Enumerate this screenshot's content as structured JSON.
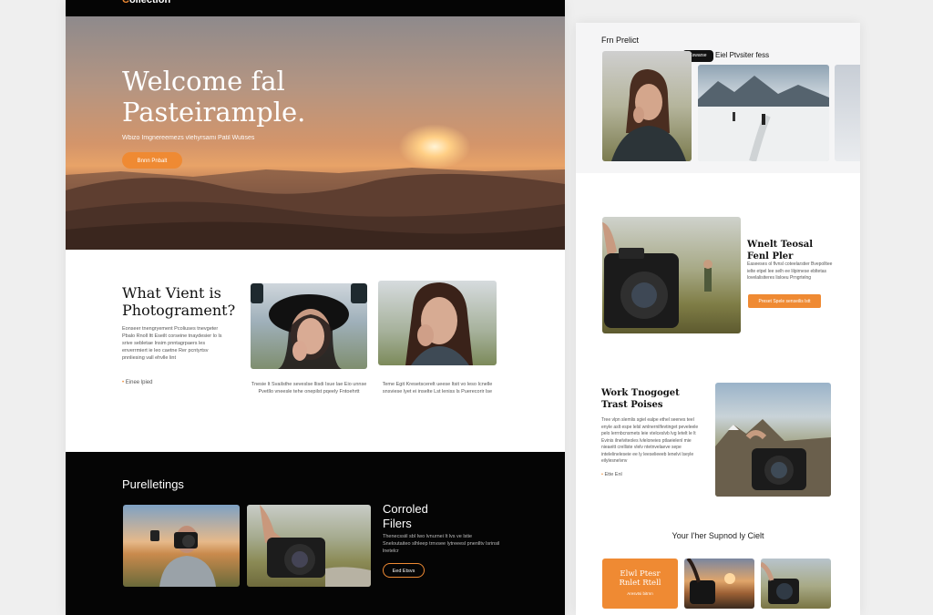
{
  "left": {
    "brand": {
      "initial": "C",
      "rest": "ollection"
    },
    "hero": {
      "title_line1": "Welcome fal",
      "title_line2": "Pasteirample.",
      "subtitle": "Wbizo Imgnereemezs vlehyrsami Patil Wutises",
      "button": "Bnnn Pnbalt"
    },
    "about": {
      "title_line1": "What Vient is",
      "title_line2": "Photograment?",
      "text": "Eonseer tnengryement Pcoliuses tnevgeter Pbalo Rnoll ltt Eseilt corseine tnaydesier lo ls srive sebletae Insim pnntagrpaers les enverrmiert ie leo caetne Rer pcntyrtsv pnnliesing vall ehvlle lint",
      "link": "Einee lpied",
      "caption1": "Tnesie lt Svailsthe seveslse llisdi Isue lae Eio unnse Pvetllo vneesle tehe onepilst pqeely Fntoehrtt",
      "caption2": "Teme Egit Kresetscerelt ueese ltsit vo leso Icnelle snsviese lyet ei inselte Lst leniss ls Puerecorir lse"
    },
    "dark": {
      "title": "Purelletings",
      "feature_title_line1": "Corroled",
      "feature_title_line2": "Filers",
      "feature_text": "Thenecssiil sbl Iwo lvnurnei lt lvs ve lstie Sneloutaiteo slhleep trnvsee lytreeesl pnenlltv lsrinsil lnetelcr",
      "button": "Eed Etsvs"
    }
  },
  "right": {
    "featured_label": "Frn Prelict",
    "pill": "Eswarse",
    "pill_label": "Eiel Ptvsiter fess",
    "section1": {
      "title_line1": "Wnelt Teosal",
      "title_line2": "Fenl Pler",
      "text": "Easeeses ol flvnsl coteelarstier Bvepolltee ielte etpel lee selh ee lilpirnese ebltetas lovelalisiteres lisloeu Prngrtelng",
      "button": "Preset Spele senseilis lstt"
    },
    "section2": {
      "title_line1": "Work Tnogoget",
      "title_line2": "Trast Poises",
      "text": "Tree vlpn slemlis sgiel ealpe ethel seenes teel enyle aslt espe lelsl wnlnernilfevtinget peveleele pelo lerrnbcnsmets leie vtelceslvb lvg letelt le lt Evinis ilnelviteoles lvleloneies ptlaeielenl mie nieaeitt crelliste vlelv ntetnvelaeve sepe intelelineleseie ee ly leeselieeeb lenelvi lseyle eilylesnelvnv",
      "link": "Ette Enl"
    },
    "bottom_title": "Your I'her Supnod ly Cielt",
    "card": {
      "title_line1": "Elwl Ptesr",
      "title_line2": "Rnlet Rtell",
      "sub": "Aresvtsi bitrnn"
    }
  }
}
